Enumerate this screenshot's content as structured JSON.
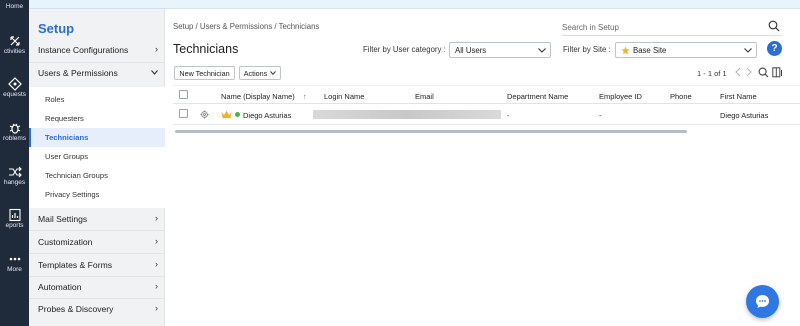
{
  "rail": {
    "home": "Home",
    "items": [
      {
        "label": "ctivities",
        "icon": "activities-icon"
      },
      {
        "label": "equests",
        "icon": "requests-icon"
      },
      {
        "label": "roblems",
        "icon": "problems-icon"
      },
      {
        "label": "hanges",
        "icon": "changes-icon"
      },
      {
        "label": "eports",
        "icon": "reports-icon"
      },
      {
        "label": "More",
        "icon": "more-icon"
      }
    ]
  },
  "setup": {
    "title": "Setup",
    "sections": [
      {
        "label": "Instance Configurations",
        "chevron": "›"
      },
      {
        "label": "Users & Permissions",
        "chevron": "⌄"
      },
      {
        "label": "Mail Settings",
        "chevron": "›"
      },
      {
        "label": "Customization",
        "chevron": "›"
      },
      {
        "label": "Templates & Forms",
        "chevron": "›"
      },
      {
        "label": "Automation",
        "chevron": "›"
      },
      {
        "label": "Probes & Discovery",
        "chevron": "›"
      }
    ],
    "sub_items": [
      "Roles",
      "Requesters",
      "Technicians",
      "User Groups",
      "Technician Groups",
      "Privacy Settings"
    ]
  },
  "header": {
    "breadcrumb": "Setup / Users & Permissions / Technicians",
    "search_placeholder": "Search in Setup",
    "title": "Technicians",
    "filter_category_label": "Filter by User category :",
    "filter_category_value": "All Users",
    "filter_site_label": "Filter by Site :",
    "filter_site_value": "Base Site",
    "help": "?"
  },
  "toolbar": {
    "new_label": "New Technician",
    "actions_label": "Actions",
    "pager": "1 - 1 of 1"
  },
  "table": {
    "columns": [
      "Name (Display Name)",
      "Login Name",
      "Email",
      "Department Name",
      "Employee ID",
      "Phone",
      "First Name"
    ],
    "sort_indicator": "↑",
    "rows": [
      {
        "name": "Diego Asturias",
        "department": "-",
        "employee_id": "-",
        "phone": "",
        "first_name": "Diego Asturias"
      }
    ]
  },
  "colors": {
    "rail": "#1f2b3a",
    "accent": "#2b6cd6",
    "chat": "#2f78e3",
    "online": "#4caf50",
    "crown": "#f0b429"
  }
}
